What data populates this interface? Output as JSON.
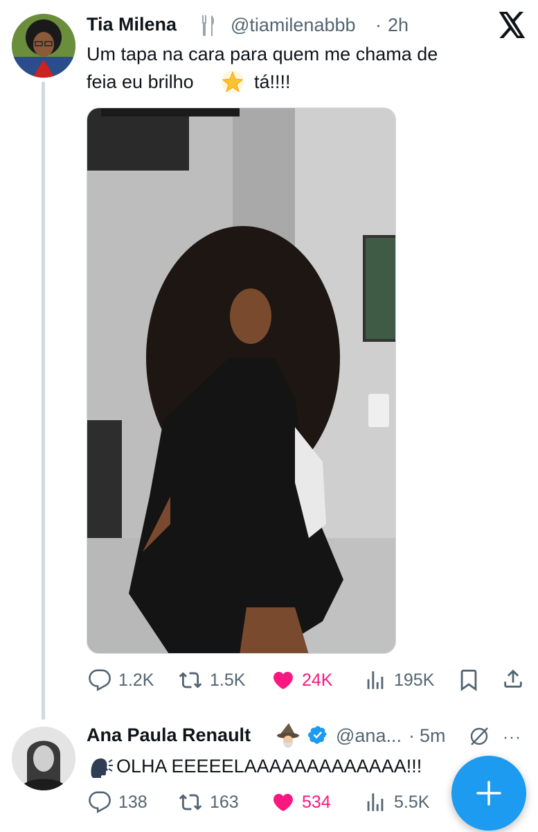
{
  "tweet": {
    "author_name": "Tia Milena",
    "handle": "@tiamilenabbb",
    "separator": "·",
    "time": "2h",
    "text_line1": "Um tapa na cara para quem me chama de",
    "text_line2": "feia eu brilho",
    "emoji": "🌟",
    "text_line2_end": "tá!!!!",
    "actions": {
      "replies": "1.2K",
      "retweets": "1.5K",
      "likes": "24K",
      "views": "195K"
    }
  },
  "reply": {
    "author_name": "Ana Paula Renault",
    "handle": "@ana...",
    "separator": "·",
    "time": "5m",
    "more": "···",
    "text": "OLHA EEEEELAAAAAAAAAAAAA!!!",
    "actions": {
      "replies": "138",
      "retweets": "163",
      "likes": "534",
      "views": "5.5K"
    }
  },
  "colors": {
    "accent": "#1d9bf0",
    "like": "#f91880",
    "muted": "#536471",
    "text": "#0f1419"
  },
  "icons": [
    "x-logo-icon",
    "fork-knife-icon",
    "reply-icon",
    "retweet-icon",
    "heart-icon",
    "views-icon",
    "bookmark-icon",
    "share-icon",
    "verified-icon",
    "wizard-icon",
    "speaking-head-icon",
    "grok-icon",
    "plus-icon"
  ]
}
